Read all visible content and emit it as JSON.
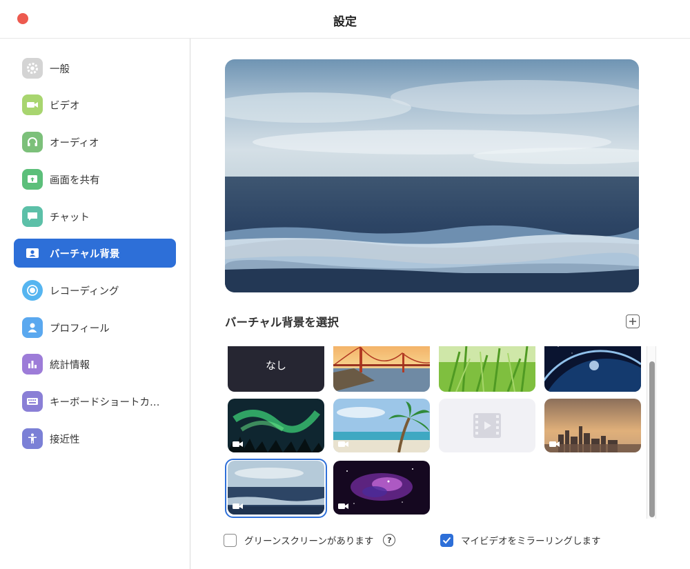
{
  "window": {
    "title": "設定"
  },
  "sidebar": {
    "items": [
      {
        "label": "一般",
        "icon": "gear-icon",
        "color": "#cfcfcf"
      },
      {
        "label": "ビデオ",
        "icon": "video-camera-icon",
        "color": "#a8d56f"
      },
      {
        "label": "オーディオ",
        "icon": "headphones-icon",
        "color": "#7cc07a"
      },
      {
        "label": "画面を共有",
        "icon": "share-screen-icon",
        "color": "#5cbf7a"
      },
      {
        "label": "チャット",
        "icon": "chat-bubble-icon",
        "color": "#5cc0a8"
      },
      {
        "label": "バーチャル背景",
        "icon": "person-card-icon",
        "color": "#2d6fd8"
      },
      {
        "label": "レコーディング",
        "icon": "record-icon",
        "color": "#56b5f0"
      },
      {
        "label": "プロフィール",
        "icon": "person-icon",
        "color": "#5aa8ef"
      },
      {
        "label": "統計情報",
        "icon": "bar-chart-icon",
        "color": "#9d7cd8"
      },
      {
        "label": "キーボードショートカ…",
        "icon": "keyboard-icon",
        "color": "#8a7fd6"
      },
      {
        "label": "接近性",
        "icon": "accessibility-icon",
        "color": "#7b80d6"
      }
    ],
    "active_index": 5
  },
  "main": {
    "select_title": "バーチャル背景を選択",
    "add_icon": "plus-box-icon",
    "none_label": "なし",
    "thumbnails": [
      {
        "name": "none",
        "video": false
      },
      {
        "name": "golden-gate-bridge",
        "video": false
      },
      {
        "name": "grass",
        "video": false
      },
      {
        "name": "earth-from-space",
        "video": false
      },
      {
        "name": "aurora",
        "video": true
      },
      {
        "name": "beach-palm",
        "video": true
      },
      {
        "name": "video-placeholder",
        "video": false
      },
      {
        "name": "city-skyline",
        "video": true
      },
      {
        "name": "ocean",
        "video": true,
        "selected": true
      },
      {
        "name": "galaxy",
        "video": true
      }
    ],
    "options": {
      "green_screen": {
        "label": "グリーンスクリーンがあります",
        "checked": false,
        "help": "?"
      },
      "mirror": {
        "label": "マイビデオをミラーリングします",
        "checked": true
      }
    }
  },
  "colors": {
    "accent": "#2d6fd8",
    "close": "#ed5a4f"
  }
}
